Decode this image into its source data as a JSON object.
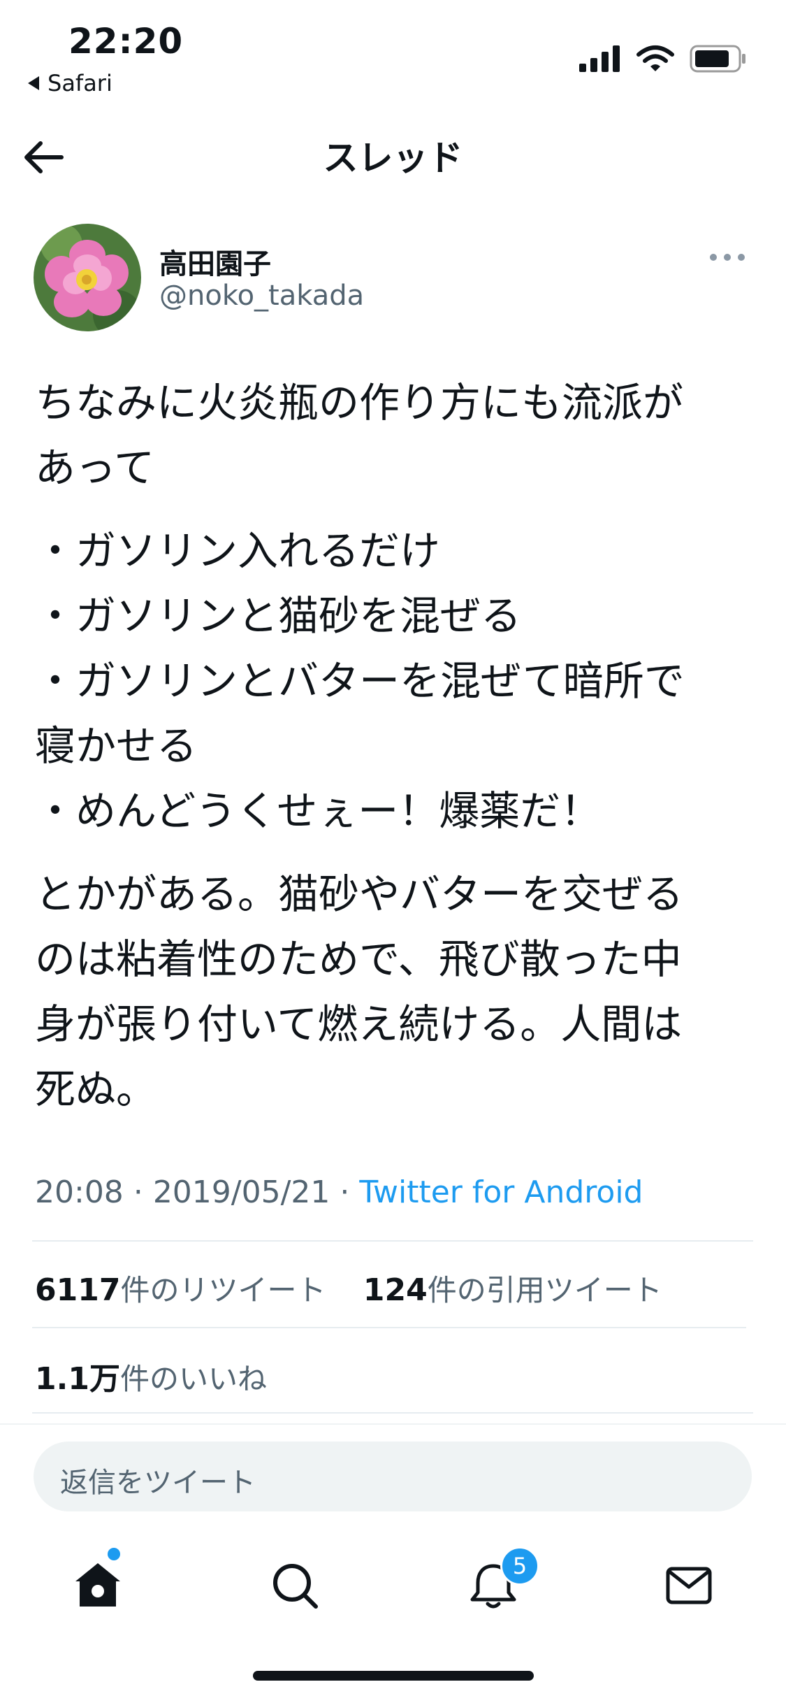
{
  "status_bar": {
    "time": "22:20",
    "back_app": "Safari",
    "icons": [
      "cellular-signal-icon",
      "wifi-icon",
      "battery-icon"
    ]
  },
  "nav": {
    "title": "スレッド",
    "back_icon": "arrow-left-icon"
  },
  "author": {
    "name": "高田園子",
    "handle": "@noko_takada",
    "more_icon": "more-horizontal-icon"
  },
  "tweet": {
    "lines": [
      "ちなみに火炎瓶の作り方にも流派が",
      "あって"
    ],
    "list_lines": [
      "・ガソリン入れるだけ",
      "・ガソリンと猫砂を混ぜる",
      "・ガソリンとバターを混ぜて暗所で",
      "寝かせる",
      "・めんどうくせぇー！爆薬だ！"
    ],
    "closing_lines": [
      "とかがある。猫砂やバターを交ぜる",
      "のは粘着性のためで、飛び散った中",
      "身が張り付いて燃え続ける。人間は",
      "死ぬ。"
    ],
    "time": "20:08",
    "sep1": "·",
    "date": "2019/05/21",
    "sep2": "·",
    "client": "Twitter for Android"
  },
  "stats": {
    "retweets_count": "6117",
    "retweets_label": "件のリツイート",
    "quotes_count": "124",
    "quotes_label": "件の引用ツイート",
    "likes_count": "1.1万",
    "likes_label": "件のいいね"
  },
  "reply": {
    "placeholder": "返信をツイート"
  },
  "tabbar": {
    "items": [
      "home-icon",
      "search-icon",
      "notifications-icon",
      "messages-icon"
    ],
    "notification_badge": "5"
  },
  "colors": {
    "accent": "#1d9bf0",
    "secondary_text": "#536471"
  }
}
